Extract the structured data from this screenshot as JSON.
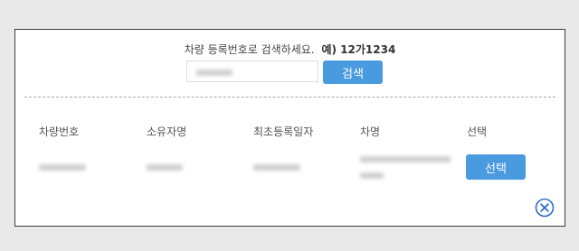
{
  "search": {
    "hint_text": "차량 등록번호로 검색하세요.",
    "hint_example": "예) 12가1234",
    "input_value": "",
    "button_label": "검색"
  },
  "table": {
    "headers": [
      "차량번호",
      "소유자명",
      "최초등록일자",
      "차명",
      "선택"
    ],
    "select_button_label": "선택"
  },
  "icons": {
    "close": "close-circle-icon"
  },
  "colors": {
    "accent": "#4a9ae0",
    "border": "#3a3a3a",
    "background": "#e9e9e9"
  }
}
